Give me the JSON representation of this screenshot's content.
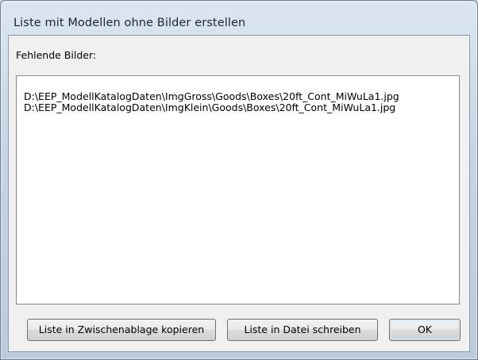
{
  "window": {
    "title": "Liste mit Modellen ohne Bilder erstellen"
  },
  "content": {
    "label": "Fehlende Bilder:",
    "items": [
      "D:\\EEP_ModellKatalogDaten\\ImgGross\\Goods\\Boxes\\20ft_Cont_MiWuLa1.jpg",
      "D:\\EEP_ModellKatalogDaten\\ImgKlein\\Goods\\Boxes\\20ft_Cont_MiWuLa1.jpg"
    ]
  },
  "buttons": {
    "copy_label": "Liste in Zwischenablage kopieren",
    "save_label": "Liste in Datei schreiben",
    "ok_label": "OK"
  }
}
